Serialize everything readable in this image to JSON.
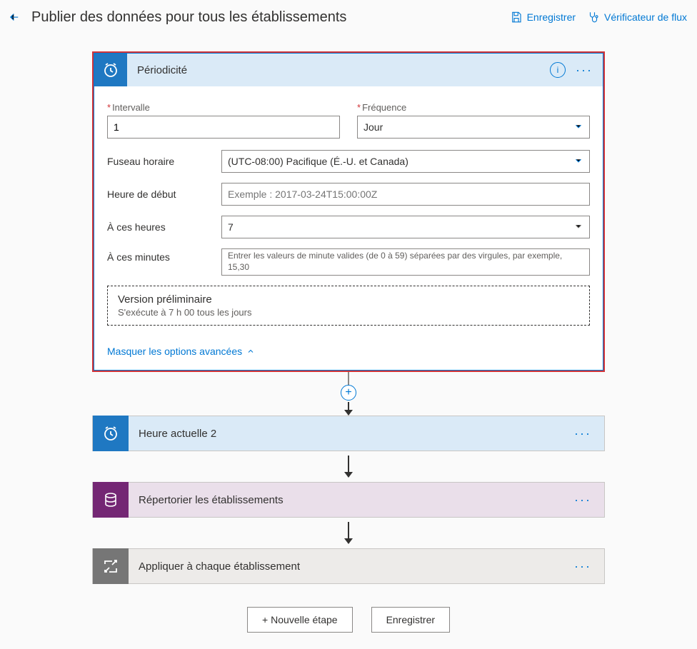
{
  "header": {
    "title": "Publier des données pour tous les établissements",
    "save": "Enregistrer",
    "flow_checker": "Vérificateur de flux"
  },
  "recurrence": {
    "title": "Périodicité",
    "interval_label": "Intervalle",
    "interval_value": "1",
    "frequency_label": "Fréquence",
    "frequency_value": "Jour",
    "timezone_label": "Fuseau horaire",
    "timezone_value": "(UTC-08:00) Pacifique (É.-U. et Canada)",
    "start_time_label": "Heure de début",
    "start_time_placeholder": "Exemple : 2017-03-24T15:00:00Z",
    "at_hours_label": "À ces heures",
    "at_hours_value": "7",
    "at_minutes_label": "À ces minutes",
    "at_minutes_placeholder": "Entrer les valeurs de minute valides (de 0 à 59) séparées par des virgules, par exemple, 15,30",
    "preview_title": "Version préliminaire",
    "preview_desc": "S'exécute à 7 h 00 tous les jours",
    "hide_advanced": "Masquer les options avancées"
  },
  "steps": {
    "current_time": "Heure actuelle 2",
    "list_establishments": "Répertorier les établissements",
    "apply_each": "Appliquer à chaque établissement"
  },
  "footer": {
    "new_step": "Nouvelle étape",
    "save": "Enregistrer"
  }
}
